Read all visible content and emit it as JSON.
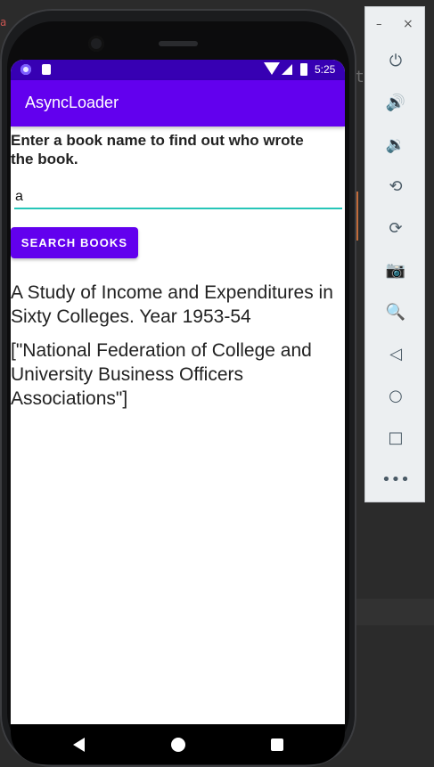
{
  "ide": {
    "ghost_char": "t",
    "red_char": "a"
  },
  "status_bar": {
    "time": "5:25"
  },
  "app": {
    "title": "AsyncLoader"
  },
  "form": {
    "prompt": "Enter a book name to find out who wrote the book.",
    "search_value": "a",
    "search_button": "SEARCH BOOKS"
  },
  "result": {
    "title": "A Study of Income and Expenditures in Sixty Colleges. Year 1953-54",
    "authors": "[\"National Federation of College and University Business Officers Associations\"]"
  },
  "emulator_toolbar": {
    "minimize": "–",
    "close": "×",
    "items": [
      {
        "icon": "power-icon",
        "glyph": "⏻"
      },
      {
        "icon": "volume-up-icon",
        "glyph": "🔊"
      },
      {
        "icon": "volume-down-icon",
        "glyph": "🔉"
      },
      {
        "icon": "rotate-left-icon",
        "glyph": "⟲"
      },
      {
        "icon": "rotate-right-icon",
        "glyph": "⟳"
      },
      {
        "icon": "camera-icon",
        "glyph": "📷"
      },
      {
        "icon": "zoom-icon",
        "glyph": "🔍"
      },
      {
        "icon": "back-icon",
        "glyph": "◁"
      },
      {
        "icon": "home-icon",
        "glyph": "○"
      },
      {
        "icon": "overview-icon",
        "glyph": "□"
      },
      {
        "icon": "more-icon",
        "glyph": "•••"
      }
    ]
  },
  "colors": {
    "primary": "#6200ee",
    "primary_dark": "#3700b3",
    "accent": "#26c6b8"
  }
}
